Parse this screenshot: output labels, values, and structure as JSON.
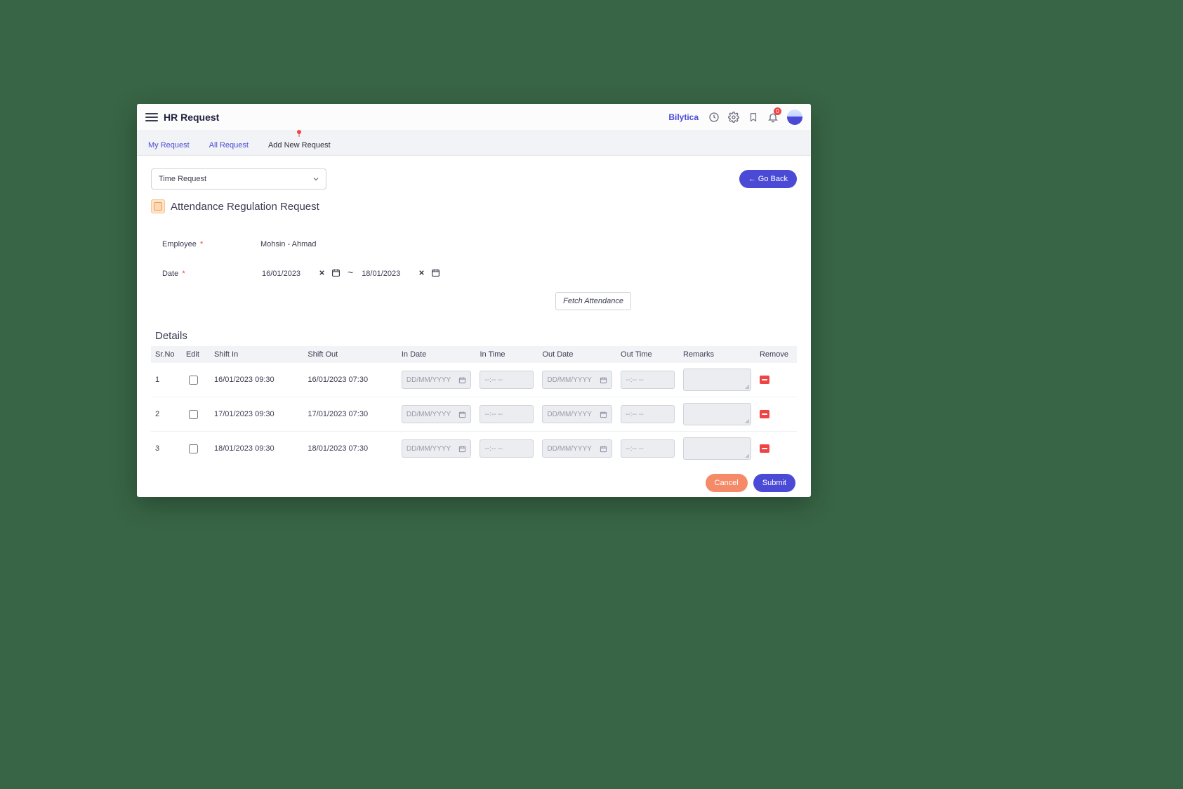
{
  "header": {
    "title": "HR Request",
    "company": "Bilytica",
    "notification_count": 0
  },
  "tabs": [
    {
      "label": "My Request",
      "active": false
    },
    {
      "label": "All Request",
      "active": false
    },
    {
      "label": "Add New Request",
      "active": true
    }
  ],
  "selector": {
    "selected": "Time Request"
  },
  "go_back_label": "← Go Back",
  "panel": {
    "title": "Attendance Regulation Request"
  },
  "form": {
    "employee_label": "Employee",
    "employee_value": "Mohsin - Ahmad",
    "date_label": "Date",
    "date_from": "16/01/2023",
    "date_to": "18/01/2023",
    "fetch_button": "Fetch Attendance"
  },
  "details": {
    "title": "Details",
    "columns": {
      "sr": "Sr.No",
      "edit": "Edit",
      "shift_in": "Shift In",
      "shift_out": "Shift Out",
      "in_date": "In Date",
      "in_time": "In Time",
      "out_date": "Out Date",
      "out_time": "Out Time",
      "remarks": "Remarks",
      "remove": "Remove"
    },
    "placeholders": {
      "date": "DD/MM/YYYY",
      "time": "--:-- --"
    },
    "rows": [
      {
        "index": "1",
        "shift_in": "16/01/2023 09:30",
        "shift_out": "16/01/2023 07:30"
      },
      {
        "index": "2",
        "shift_in": "17/01/2023 09:30",
        "shift_out": "17/01/2023 07:30"
      },
      {
        "index": "3",
        "shift_in": "18/01/2023 09:30",
        "shift_out": "18/01/2023 07:30"
      }
    ]
  },
  "actions": {
    "cancel": "Cancel",
    "submit": "Submit"
  }
}
